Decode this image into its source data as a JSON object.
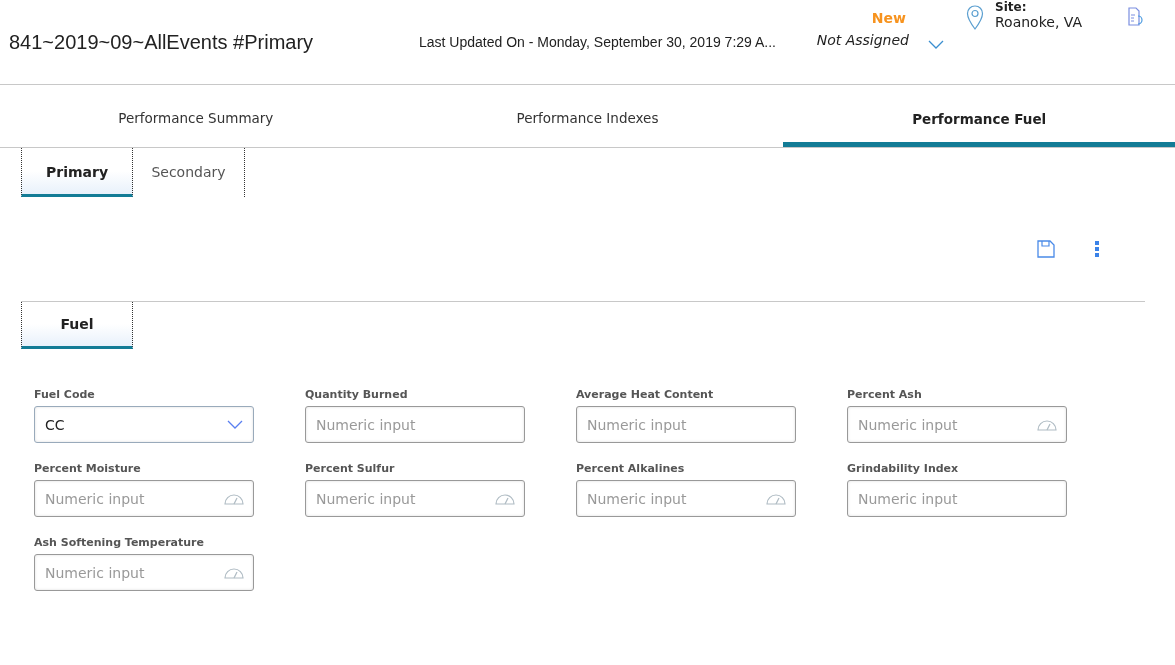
{
  "header": {
    "title": "841~2019~09~AllEvents #Primary",
    "last_updated": "Last Updated On - Monday, September 30, 2019 7:29 A...",
    "status": "New",
    "assignee": "Not Assigned",
    "site_label": "Site:",
    "site": "Roanoke, VA"
  },
  "tabs": [
    {
      "label": "Performance Summary",
      "selected": false
    },
    {
      "label": "Performance Indexes",
      "selected": false
    },
    {
      "label": "Performance Fuel",
      "selected": true
    }
  ],
  "subtabs": [
    {
      "label": "Primary",
      "selected": true
    },
    {
      "label": "Secondary",
      "selected": false
    }
  ],
  "section_tabs": [
    {
      "label": "Fuel",
      "selected": true
    }
  ],
  "fields": [
    {
      "label": "Fuel Code",
      "kind": "select",
      "value": "CC"
    },
    {
      "label": "Quantity Burned",
      "kind": "number",
      "placeholder": "Numeric input"
    },
    {
      "label": "Average Heat Content",
      "kind": "number",
      "placeholder": "Numeric input"
    },
    {
      "label": "Percent Ash",
      "kind": "measured",
      "placeholder": "Numeric input"
    },
    {
      "label": "Percent Moisture",
      "kind": "measured",
      "placeholder": "Numeric input"
    },
    {
      "label": "Percent Sulfur",
      "kind": "measured",
      "placeholder": "Numeric input"
    },
    {
      "label": "Percent Alkalines",
      "kind": "measured",
      "placeholder": "Numeric input"
    },
    {
      "label": "Grindability Index",
      "kind": "number",
      "placeholder": "Numeric input"
    },
    {
      "label": "Ash Softening Temperature",
      "kind": "measured",
      "placeholder": "Numeric input"
    }
  ]
}
